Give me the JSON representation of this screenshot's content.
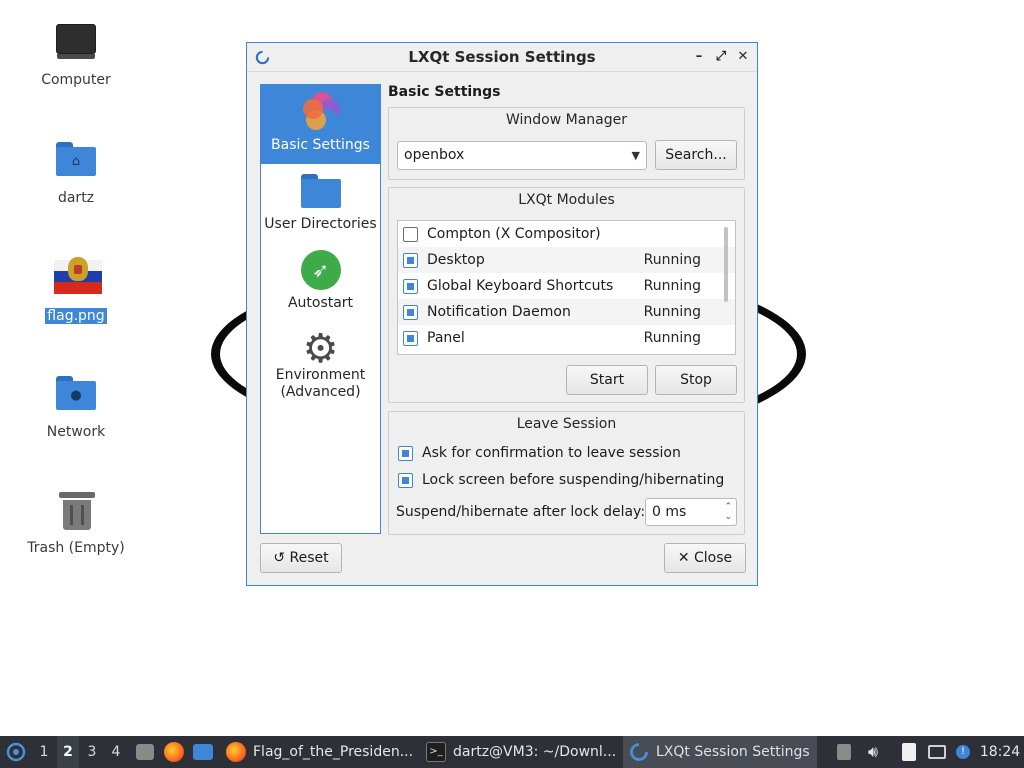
{
  "desktop": {
    "icons": [
      {
        "label": "Computer",
        "icon": "computer-icon"
      },
      {
        "label": "dartz",
        "icon": "home-folder-icon"
      },
      {
        "label": "flag.png",
        "icon": "image-file-icon"
      },
      {
        "label": "Network",
        "icon": "network-folder-icon"
      },
      {
        "label": "Trash (Empty)",
        "icon": "trash-icon"
      }
    ]
  },
  "window": {
    "title": "LXQt Session Settings",
    "controls": {
      "minimize": "–",
      "maximize": "⤢",
      "close": "✕"
    },
    "sidebar": [
      {
        "label": "Basic Settings",
        "icon": "lxqt-logo-icon",
        "active": true
      },
      {
        "label": "User Directories",
        "icon": "folder-icon",
        "active": false
      },
      {
        "label": "Autostart",
        "icon": "rocket-icon",
        "active": false
      },
      {
        "label": "Environment (Advanced)",
        "icon": "gear-icon",
        "active": false
      }
    ],
    "page_title": "Basic Settings",
    "window_manager": {
      "title": "Window Manager",
      "value": "openbox",
      "search_label": "Search..."
    },
    "modules": {
      "title": "LXQt Modules",
      "rows": [
        {
          "name": "Compton (X Compositor)",
          "checked": false,
          "status": ""
        },
        {
          "name": "Desktop",
          "checked": true,
          "status": "Running"
        },
        {
          "name": "Global Keyboard Shortcuts",
          "checked": true,
          "status": "Running"
        },
        {
          "name": "Notification Daemon",
          "checked": true,
          "status": "Running"
        },
        {
          "name": "Panel",
          "checked": true,
          "status": "Running"
        }
      ],
      "start_label": "Start",
      "stop_label": "Stop"
    },
    "leave_session": {
      "title": "Leave Session",
      "confirm_label": "Ask for confirmation to leave session",
      "confirm_checked": true,
      "lock_label": "Lock screen before suspending/hibernating",
      "lock_checked": true,
      "delay_label": "Suspend/hibernate after lock delay:",
      "delay_value": "0 ms"
    },
    "reset_label": "Reset",
    "close_label": "Close"
  },
  "taskbar": {
    "workspaces": [
      "1",
      "2",
      "3",
      "4"
    ],
    "active_workspace": "2",
    "tasks": [
      {
        "label": "Flag_of_the_Presiden...",
        "icon": "firefox-icon"
      },
      {
        "label": "dartz@VM3: ~/Downl...",
        "icon": "terminal-icon"
      },
      {
        "label": "LXQt Session Settings",
        "icon": "lxqt-icon",
        "active": true
      }
    ],
    "clock": "18:24"
  },
  "colors": {
    "accent": "#3d86d8",
    "taskbar": "#2d3036",
    "window_bg": "#efefef"
  }
}
